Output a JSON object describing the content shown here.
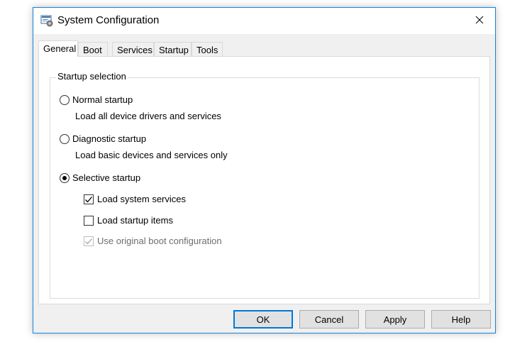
{
  "window": {
    "title": "System Configuration",
    "close_icon": "close-icon",
    "app_icon": "system-config-icon"
  },
  "tabs": [
    {
      "label": "General",
      "active": true
    },
    {
      "label": "Boot",
      "active": false
    },
    {
      "label": "Services",
      "active": false
    },
    {
      "label": "Startup",
      "active": false
    },
    {
      "label": "Tools",
      "active": false
    }
  ],
  "startup_selection": {
    "legend": "Startup selection",
    "normal": {
      "label": "Normal startup",
      "desc": "Load all device drivers and services",
      "selected": false
    },
    "diagnostic": {
      "label": "Diagnostic startup",
      "desc": "Load basic devices and services only",
      "selected": false
    },
    "selective": {
      "label": "Selective startup",
      "selected": true
    },
    "options": [
      {
        "label": "Load system services",
        "checked": true,
        "disabled": false
      },
      {
        "label": "Load startup items",
        "checked": false,
        "disabled": false
      },
      {
        "label": "Use original boot configuration",
        "checked": true,
        "disabled": true
      }
    ]
  },
  "buttons": {
    "ok": "OK",
    "cancel": "Cancel",
    "apply": "Apply",
    "help": "Help"
  },
  "colors": {
    "window_border": "#1883d7",
    "default_button_border": "#0078d7"
  }
}
